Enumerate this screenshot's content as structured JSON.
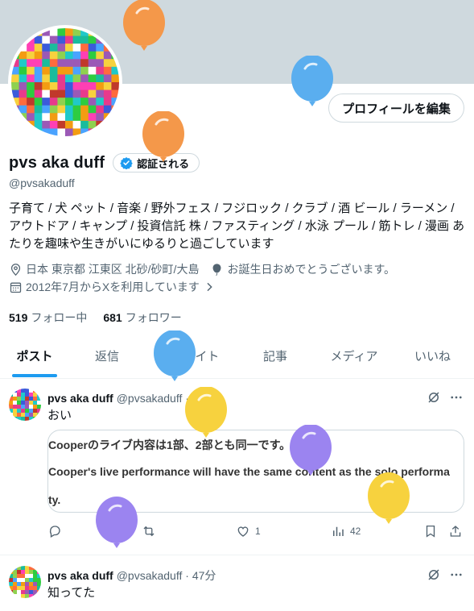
{
  "profile": {
    "display_name": "pvs aka duff",
    "verified_label": "認証される",
    "handle": "@pvsakaduff",
    "edit_button": "プロフィールを編集",
    "bio": "子育て / 犬 ペット / 音楽 / 野外フェス / フジロック / クラブ / 酒 ビール / ラーメン / アウトドア / キャンプ / 投資信託 株 / ファスティング / 水泳 プール / 筋トレ / 漫画 あたりを趣味や生きがいにゆるりと過ごしています",
    "location": "日本 東京都 江東区 北砂/砂町/大島",
    "birthday": "お誕生日おめでとうございます。",
    "joined": "2012年7月からXを利用しています",
    "following_count": "519",
    "following_label": "フォロー中",
    "followers_count": "681",
    "followers_label": "フォロワー"
  },
  "tabs": [
    {
      "label": "ポスト"
    },
    {
      "label": "返信"
    },
    {
      "label": "ハイライト"
    },
    {
      "label": "記事"
    },
    {
      "label": "メディア"
    },
    {
      "label": "いいね"
    }
  ],
  "posts": [
    {
      "name": "pvs aka duff",
      "handle_time": "@pvsakaduff · 24分",
      "text": "おい",
      "quote_lines": [
        "Cooperのライブ内容は1部、2部とも同一です。",
        "Cooper's live performance will have the same content as the solo performa",
        "ty."
      ],
      "likes": "1",
      "views": "42"
    },
    {
      "name": "pvs aka duff",
      "handle_time": "@pvsakaduff · 47分",
      "text": "知ってた"
    }
  ],
  "colors": {
    "accent": "#1d9bf0",
    "banner": "#cfd9de",
    "balloon_orange": "#f4984a",
    "balloon_blue": "#5aaeef",
    "balloon_yellow": "#f7d23e",
    "balloon_purple": "#9b84f0"
  }
}
